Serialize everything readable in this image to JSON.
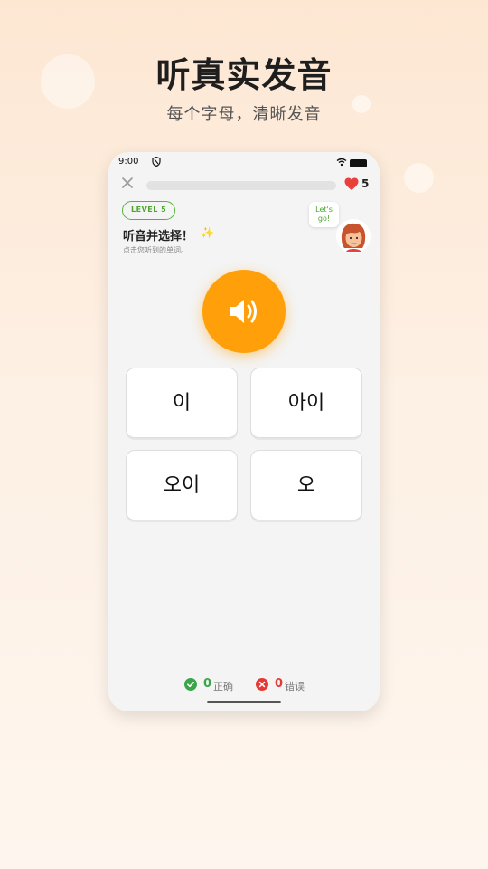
{
  "promo": {
    "headline": "听真实发音",
    "subline": "每个字母，清晰发音"
  },
  "status_bar": {
    "time": "9:00",
    "icons": [
      "shield-icon",
      "wifi-icon",
      "battery-icon"
    ]
  },
  "lesson": {
    "close_icon": "close-icon",
    "progress": 0,
    "lives": "5",
    "level": "LEVEL 5",
    "title": "听音并选择！",
    "sparkle": "✨",
    "hint": "点击您听到的单词。",
    "speech_line1": "Let's",
    "speech_line2": "go!"
  },
  "options": [
    "이",
    "아이",
    "오이",
    "오"
  ],
  "score": {
    "correct_count": "0",
    "correct_label": "正确",
    "wrong_count": "0",
    "wrong_label": "错误"
  },
  "colors": {
    "accent_orange": "#ff9f0a",
    "accent_green": "#58b33a",
    "error_red": "#e53935",
    "heart_red": "#e8413b"
  }
}
